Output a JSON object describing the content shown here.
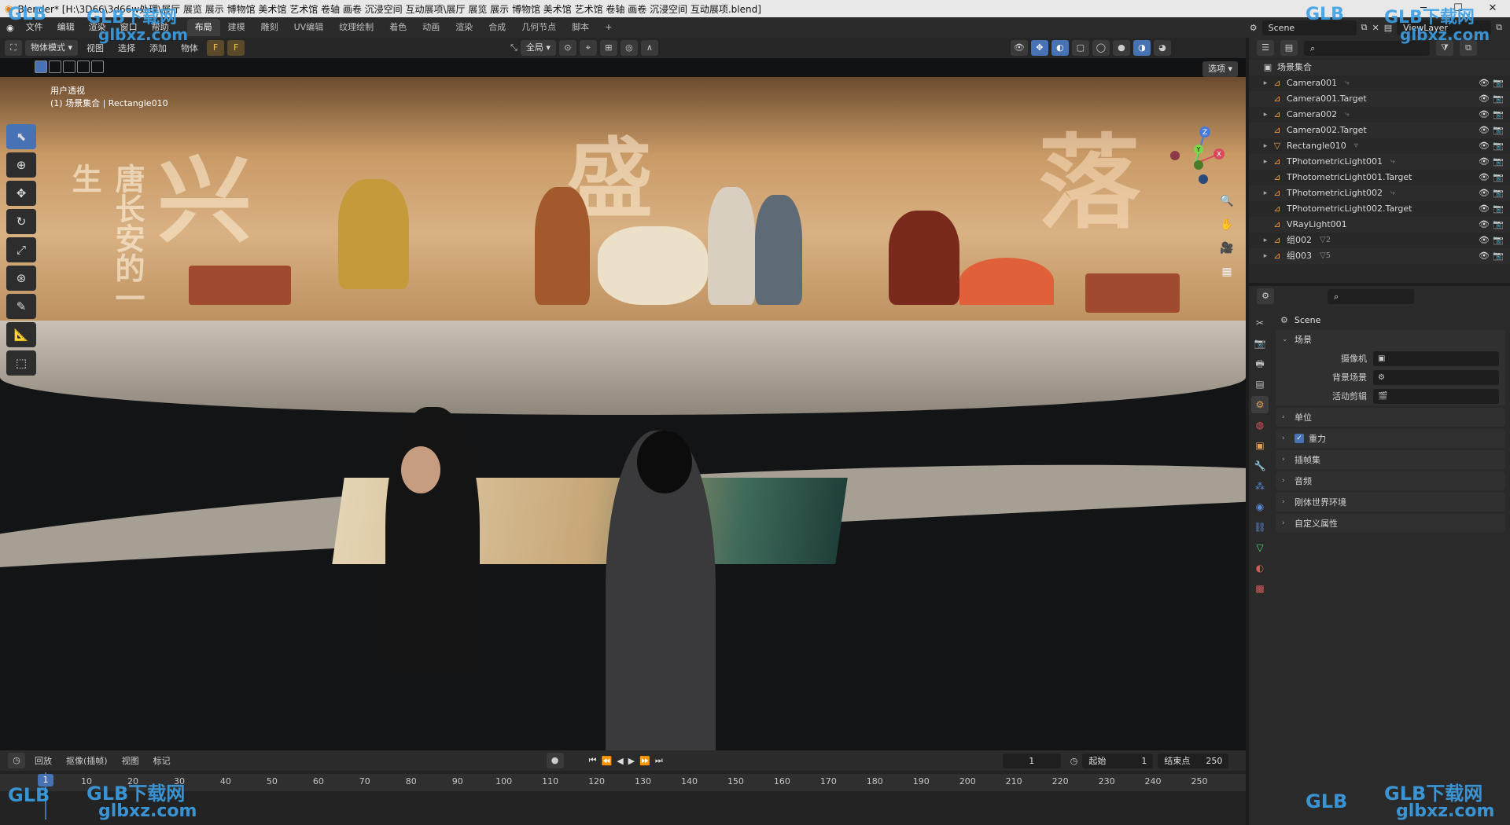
{
  "window": {
    "title": "Blender* [H:\\3D66\\3d66w处理\\展厅 展览 展示 博物馆 美术馆 艺术馆 卷轴 画卷 沉浸空间 互动展项\\展厅 展览 展示 博物馆 美术馆 艺术馆 卷轴 画卷 沉浸空间 互动展项.blend]"
  },
  "menu": [
    "文件",
    "编辑",
    "渲染",
    "窗口",
    "帮助"
  ],
  "workspaces": [
    "布局",
    "建模",
    "雕刻",
    "UV编辑",
    "纹理绘制",
    "着色",
    "动画",
    "渲染",
    "合成",
    "几何节点",
    "脚本"
  ],
  "active_workspace": "布局",
  "scene_name": "Scene",
  "view_layer": "ViewLayer",
  "viewport": {
    "mode": "物体模式",
    "menu": [
      "视图",
      "选择",
      "添加",
      "物体"
    ],
    "transform_orientation": "全局",
    "options_label": "选项",
    "info_line1": "用户透视",
    "info_line2": "(1) 场景集合 | Rectangle010"
  },
  "mural_chars": [
    "兴",
    "盛",
    "落"
  ],
  "mural_subtitle": "唐长安的一生",
  "gizmo": {
    "z": "Z",
    "y": "Y",
    "x": "X"
  },
  "outliner": {
    "root": "场景集合",
    "items": [
      {
        "name": "Camera001",
        "expand": "▸",
        "icon": "⊿",
        "extra": "⤷"
      },
      {
        "name": "Camera001.Target",
        "expand": "",
        "icon": "⊿",
        "extra": ""
      },
      {
        "name": "Camera002",
        "expand": "▸",
        "icon": "⊿",
        "extra": "⤷"
      },
      {
        "name": "Camera002.Target",
        "expand": "",
        "icon": "⊿",
        "extra": ""
      },
      {
        "name": "Rectangle010",
        "expand": "▸",
        "icon": "▽",
        "extra": "▿"
      },
      {
        "name": "TPhotometricLight001",
        "expand": "▸",
        "icon": "⊿",
        "extra": "⤷"
      },
      {
        "name": "TPhotometricLight001.Target",
        "expand": "",
        "icon": "⊿",
        "extra": ""
      },
      {
        "name": "TPhotometricLight002",
        "expand": "▸",
        "icon": "⊿",
        "extra": "⤷"
      },
      {
        "name": "TPhotometricLight002.Target",
        "expand": "",
        "icon": "⊿",
        "extra": ""
      },
      {
        "name": "VRayLight001",
        "expand": "",
        "icon": "⊿",
        "extra": ""
      },
      {
        "name": "组002",
        "expand": "▸",
        "icon": "⊿",
        "extra": "▽2"
      },
      {
        "name": "组003",
        "expand": "▸",
        "icon": "⊿",
        "extra": "▽5"
      }
    ]
  },
  "properties": {
    "title": "Scene",
    "scene_panel": "场景",
    "camera_label": "摄像机",
    "bg_scene_label": "背景场景",
    "active_clip_label": "活动剪辑",
    "panels": [
      "单位",
      "重力",
      "插帧集",
      "音频",
      "刚体世界环境",
      "自定义属性"
    ],
    "gravity_checked": "✓"
  },
  "timeline": {
    "menu": [
      "回放",
      "抠像(插帧)",
      "视图",
      "标记"
    ],
    "current_frame": "1",
    "start_label": "起始",
    "start": "1",
    "end_label": "结束点",
    "end": "250",
    "ticks": [
      "1",
      "10",
      "20",
      "30",
      "40",
      "50",
      "60",
      "70",
      "80",
      "90",
      "100",
      "110",
      "120",
      "130",
      "140",
      "150",
      "160",
      "170",
      "180",
      "190",
      "200",
      "210",
      "220",
      "230",
      "240",
      "250"
    ]
  },
  "watermark": {
    "brand": "GLB下载网",
    "url": "glbxz.com",
    "logo": "GLB"
  }
}
